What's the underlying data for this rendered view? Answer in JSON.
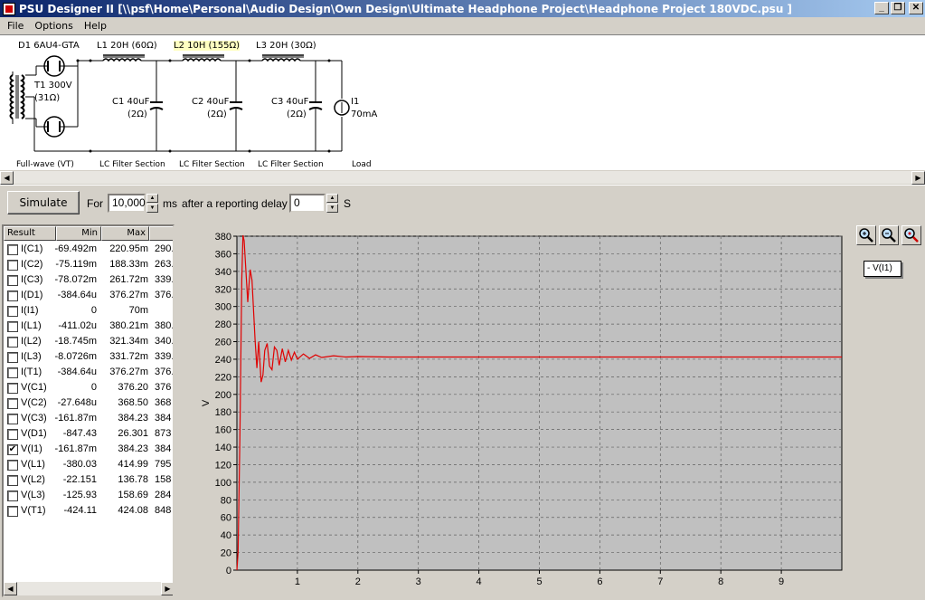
{
  "window": {
    "title": "PSU Designer II  [\\\\psf\\Home\\Personal\\Audio Design\\Own Design\\Ultimate Headphone Project\\Headphone Project 180VDC.psu ]",
    "buttons": [
      "_",
      "❐",
      "✕"
    ]
  },
  "menu": [
    "File",
    "Options",
    "Help"
  ],
  "schematic": {
    "d1": "D1 6AU4-GTA",
    "t1_a": "T1 300V",
    "t1_b": "(31Ω)",
    "l1": "L1 20H (60Ω)",
    "l2": "L2 10H (155Ω)",
    "l3": "L3 20H (30Ω)",
    "c1_a": "C1 40uF",
    "c1_b": "(2Ω)",
    "c2_a": "C2 40uF",
    "c2_b": "(2Ω)",
    "c3_a": "C3 40uF",
    "c3_b": "(2Ω)",
    "i1_a": "I1",
    "i1_b": "70mA",
    "sections": [
      "Full-wave (VT)",
      "LC Filter Section",
      "LC Filter Section",
      "LC Filter Section",
      "Load"
    ]
  },
  "toolbar": {
    "simulate": "Simulate",
    "for_label": "For",
    "duration": "10,000",
    "ms_label": "ms",
    "after_label": "after a reporting delay of",
    "delay": "0",
    "s_label": "S"
  },
  "results": {
    "columns": [
      "Result",
      "Min",
      "Max"
    ],
    "rows": [
      {
        "name": "I(C1)",
        "min": "-69.492m",
        "max": "220.95m",
        "extra": "290.",
        "checked": false
      },
      {
        "name": "I(C2)",
        "min": "-75.119m",
        "max": "188.33m",
        "extra": "263.",
        "checked": false
      },
      {
        "name": "I(C3)",
        "min": "-78.072m",
        "max": "261.72m",
        "extra": "339.",
        "checked": false
      },
      {
        "name": "I(D1)",
        "min": "-384.64u",
        "max": "376.27m",
        "extra": "376.",
        "checked": false
      },
      {
        "name": "I(I1)",
        "min": "0",
        "max": "70m",
        "extra": "",
        "checked": false
      },
      {
        "name": "I(L1)",
        "min": "-411.02u",
        "max": "380.21m",
        "extra": "380.",
        "checked": false
      },
      {
        "name": "I(L2)",
        "min": "-18.745m",
        "max": "321.34m",
        "extra": "340.",
        "checked": false
      },
      {
        "name": "I(L3)",
        "min": "-8.0726m",
        "max": "331.72m",
        "extra": "339.",
        "checked": false
      },
      {
        "name": "I(T1)",
        "min": "-384.64u",
        "max": "376.27m",
        "extra": "376.",
        "checked": false
      },
      {
        "name": "V(C1)",
        "min": "0",
        "max": "376.20",
        "extra": "376",
        "checked": false
      },
      {
        "name": "V(C2)",
        "min": "-27.648u",
        "max": "368.50",
        "extra": "368",
        "checked": false
      },
      {
        "name": "V(C3)",
        "min": "-161.87m",
        "max": "384.23",
        "extra": "384",
        "checked": false
      },
      {
        "name": "V(D1)",
        "min": "-847.43",
        "max": "26.301",
        "extra": "873",
        "checked": false
      },
      {
        "name": "V(I1)",
        "min": "-161.87m",
        "max": "384.23",
        "extra": "384",
        "checked": true
      },
      {
        "name": "V(L1)",
        "min": "-380.03",
        "max": "414.99",
        "extra": "795",
        "checked": false
      },
      {
        "name": "V(L2)",
        "min": "-22.151",
        "max": "136.78",
        "extra": "158",
        "checked": false
      },
      {
        "name": "V(L3)",
        "min": "-125.93",
        "max": "158.69",
        "extra": "284",
        "checked": false
      },
      {
        "name": "V(T1)",
        "min": "-424.11",
        "max": "424.08",
        "extra": "848",
        "checked": false
      }
    ]
  },
  "graph": {
    "legend": "- V(I1)",
    "zoom_buttons": [
      "zoom-in-icon",
      "zoom-out-icon",
      "zoom-fit-icon"
    ]
  },
  "chart_data": {
    "type": "line",
    "ylabel": "V",
    "xlabel": "",
    "xlim": [
      0,
      10
    ],
    "ylim": [
      0,
      380
    ],
    "xticks": [
      1,
      2,
      3,
      4,
      5,
      6,
      7,
      8,
      9
    ],
    "yticks": [
      0,
      20,
      40,
      60,
      80,
      100,
      120,
      140,
      160,
      180,
      200,
      220,
      240,
      260,
      280,
      300,
      320,
      340,
      360,
      380
    ],
    "grid": true,
    "line_color": "#e00000",
    "series": [
      {
        "name": "V(I1)",
        "x": [
          0,
          0.02,
          0.05,
          0.08,
          0.1,
          0.12,
          0.15,
          0.18,
          0.2,
          0.22,
          0.25,
          0.28,
          0.3,
          0.33,
          0.36,
          0.4,
          0.43,
          0.46,
          0.5,
          0.54,
          0.58,
          0.62,
          0.66,
          0.7,
          0.75,
          0.8,
          0.85,
          0.9,
          0.95,
          1.0,
          1.1,
          1.2,
          1.3,
          1.4,
          1.6,
          1.8,
          2.0,
          2.5,
          3.0,
          4.0,
          5.0,
          6.0,
          7.0,
          8.0,
          9.0,
          10.0
        ],
        "y": [
          0,
          20,
          150,
          330,
          381,
          375,
          340,
          305,
          325,
          342,
          330,
          290,
          262,
          230,
          260,
          214,
          222,
          250,
          258,
          232,
          228,
          254,
          250,
          233,
          252,
          237,
          250,
          239,
          248,
          240,
          246,
          241,
          245,
          242,
          244,
          242.5,
          243,
          242.5,
          242.5,
          242.5,
          242.5,
          242.5,
          242.5,
          242.5,
          242.5,
          242.5
        ]
      }
    ]
  }
}
